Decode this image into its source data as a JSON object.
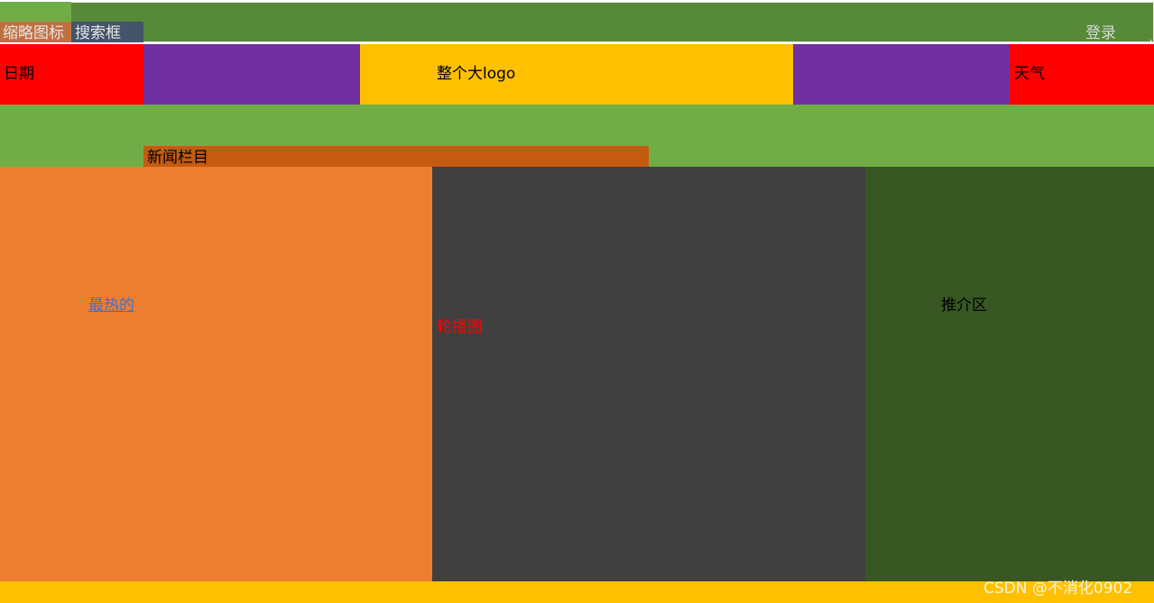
{
  "header": {
    "thumbnail_label": "缩略图标",
    "search_label": "搜索框",
    "login_label": "登录"
  },
  "banner": {
    "date_label": "日期",
    "logo_label": "整个大logo",
    "weather_label": "天气"
  },
  "nav": {
    "news_label": "新闻栏目"
  },
  "main": {
    "hot_label": "最热的",
    "carousel_label": "轮播图",
    "recommend_label": "推介区"
  },
  "footer": {
    "watermark": "CSDN @不消化0902"
  },
  "colors": {
    "top_bar": "#568a38",
    "thumbnail": "#70ad47",
    "search": "#44546a",
    "date_weather": "#ff0000",
    "side_blocks": "#7030a0",
    "logo": "#ffc000",
    "news": "#c55a11",
    "hot": "#ed7d31",
    "carousel": "#404040",
    "recommend": "#385723",
    "footer": "#ffc000"
  }
}
